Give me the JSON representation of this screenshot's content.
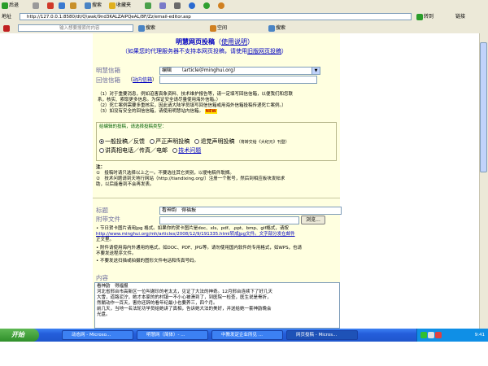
{
  "toolbar": {
    "back": "后退",
    "search": "搜索",
    "favorites": "收藏夹"
  },
  "address_bar": {
    "label": "地址",
    "url": "http://127.0.0.1:8580/dt/Q\\wak/9nd3KALZAiPQeAL/8F/Zz/email-editor.asp",
    "go": "转到",
    "links": "链接"
  },
  "search_bar": {
    "placeholder": "输入想要搜索的内容",
    "search_btn": "搜索",
    "space": "空间",
    "search2": "搜索"
  },
  "page": {
    "title": "明慧网页投稿",
    "title_link": "使用说明",
    "subtitle_pre": "（如果您的代理服务器不支持本网页投稿，请使用",
    "subtitle_link": "旧版网页投稿",
    "subtitle_post": "）",
    "mailbox_label": "明慧信箱",
    "mailbox_value": "编辑　　（article＠minghui.org）",
    "reply_label": "回信信箱",
    "reply_link": "站内信箱",
    "notes": [
      "（1）对于重要消息，例如迫害真象资料、技术维护报告等，请一定填写回信信箱，以便我们和您联",
      "系，核实、索取更多信息。为保证安全请尽量使用海外信箱。）",
      "（2）死亡案例需要多重核实，因此请大陆学员填写回信信箱或用海外信箱投稿传递死亡案例。）",
      "（3）如没有安全的回信信箱，请使用明慧站内信箱。"
    ],
    "notes_new": "NEW",
    "category_legend": "给编辑的投稿，请选择投稿类型：",
    "categories": [
      "一般投稿／反馈",
      "严正声明投稿",
      "退党声明投稿",
      "（将转交给《大纪元》刊登）",
      "讲真相电话／传真／电邮",
      "技术问题"
    ],
    "note_title": "注：",
    "category_notes": [
      "①　投稿时请只选择以上之一。不要选往其它类别，以便电稿件耽搁。",
      "②　技术问题请到天地行网站（http://tiandixing.org/）注册一个账号，然后到相应板块发帖求",
      "助，以后能看到不会再发表。"
    ],
    "subject_label": "标题",
    "subject_value": "看神韵　得福报",
    "attach_label": "附带文件",
    "browse_btn": "浏览...",
    "attach_notes": [
      "• 节日贺卡图片请用jpg 格式。如果你的贺卡图片是doc、xls、pdf、.ppt、bmp、gif格式，请按",
      "http://www.minghui.org/mh/articles/2008/12/9/191335.html转成jpg文件。文字部分发在邮件",
      "正文里。",
      "• 附件请使用海内外通用的格式，如DOC、PDF、JPG等。请勿使用国内软件的专用格式，如WPS，也请",
      "不要发送程序文件。",
      "• 不要发送扫描或拍摄的图形文件电话和传真号码。"
    ],
    "content_label": "内容",
    "content_lines": [
      "看神韵　得福报",
      "河北省邢台市高新区一位叫谢珍的老太太，见证了大法的神奇。12月邢台连续下了好几天",
      "大雪，道路泥泞，她才本家的的村镇一不小心被滑到了，到医院一检查，医生说是骨折，",
      "然躺动作一百天，害你还辞的看年纪最小也要养三，四个月。",
      "前几天，当地一名法轮功学员给她讲了真相，告诉她大法的美好，并送给她一套神韵晚会",
      "光盘。"
    ]
  },
  "taskbar": {
    "start": "开始",
    "tasks": [
      "动态网 - Microso...",
      "明慧网（简体）- ...",
      "中教发定企业所见 ...",
      "网页投稿 - Micros..."
    ],
    "clock": "9:41"
  },
  "colors": {
    "form_bg": "#ffffe0",
    "title_blue": "#0000c0",
    "label_gray": "#6f6f9f",
    "taskbar_blue": "#245edb"
  }
}
